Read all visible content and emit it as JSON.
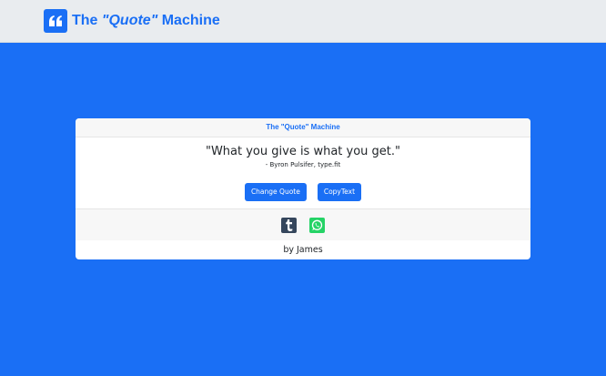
{
  "navbar": {
    "brand_prefix": "The ",
    "brand_emphasis": "\"Quote\"",
    "brand_suffix": " Machine",
    "brand_icon": "quote-left-icon"
  },
  "card": {
    "header_title": "The \"Quote\" Machine",
    "quote": "\"What you give is what you get.\"",
    "author": "- Byron Pulsifer, type.fit",
    "buttons": {
      "change_quote": "Change Quote",
      "copy_text": "CopyText"
    },
    "share": {
      "tumblr_icon": "tumblr-icon",
      "whatsapp_icon": "whatsapp-icon"
    },
    "footer": "by James"
  },
  "colors": {
    "background": "#1a6ff5",
    "accent": "#1a6ff5",
    "tumblr": "#35465c",
    "whatsapp": "#25d366"
  }
}
